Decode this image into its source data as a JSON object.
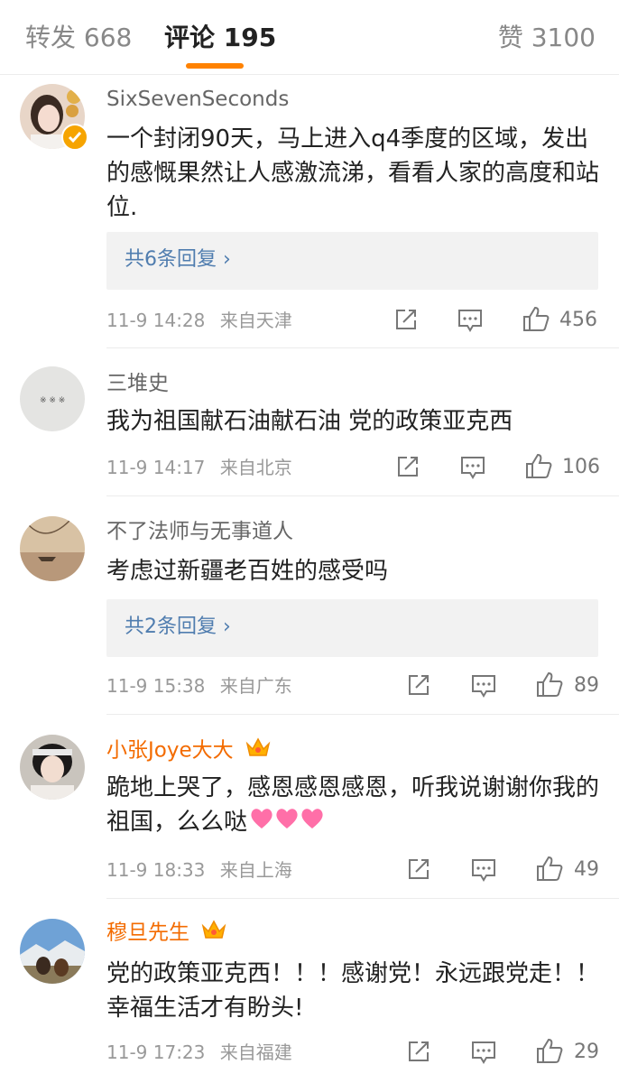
{
  "tabs": {
    "repost": "转发 668",
    "comments": "评论 195",
    "likes": "赞 3100"
  },
  "colors": {
    "accent": "#ff8200",
    "link": "#507daf",
    "vip_name": "#f36b00"
  },
  "comments": [
    {
      "username": "SixSevenSeconds",
      "verified": true,
      "text": "一个封闭90天，马上进入q4季度的区域，发出的感慨果然让人感激流涕，看看人家的高度和站位.",
      "replies": "共6条回复 ›",
      "time": "11-9 14:28",
      "location": "来自天津",
      "likes": "456"
    },
    {
      "username": "三堆史",
      "text": "我为祖国献石油献石油 党的政策亚克西",
      "time": "11-9 14:17",
      "location": "来自北京",
      "likes": "106"
    },
    {
      "username": "不了法师与无事道人",
      "text": "考虑过新疆老百姓的感受吗",
      "replies": "共2条回复 ›",
      "time": "11-9 15:38",
      "location": "来自广东",
      "likes": "89"
    },
    {
      "username": "小张Joye大大",
      "vip": true,
      "text": "跪地上哭了，感恩感恩感恩，听我说谢谢你我的祖国，么么哒",
      "time": "11-9 18:33",
      "location": "来自上海",
      "likes": "49"
    },
    {
      "username": "穆旦先生",
      "vip": true,
      "text": "党的政策亚克西！！！感谢党！永远跟党走！！幸福生活才有盼头!",
      "time": "11-9 17:23",
      "location": "来自福建",
      "likes": "29"
    }
  ],
  "icons": [
    "repost-icon",
    "comment-icon",
    "like-icon",
    "verified-badge-icon",
    "vip-crown-icon",
    "heart-emoji-icon"
  ]
}
